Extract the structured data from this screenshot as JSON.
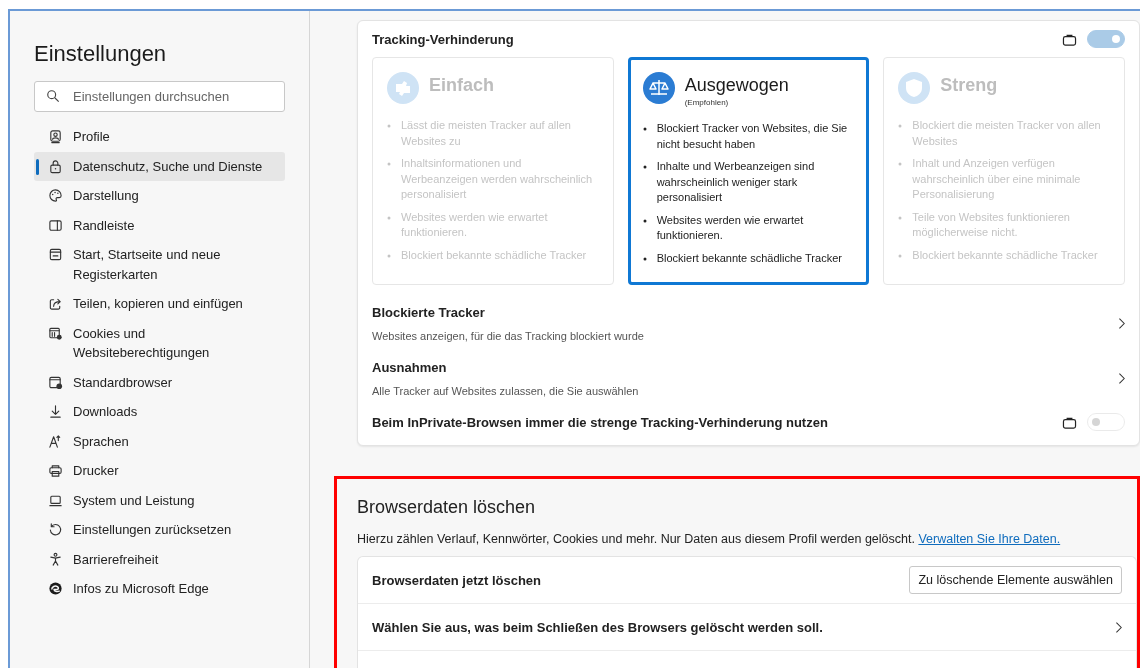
{
  "sidebar": {
    "title": "Einstellungen",
    "search": {
      "placeholder": "Einstellungen durchsuchen"
    },
    "items": [
      {
        "label": "Profile",
        "kind": "profile",
        "selected": false
      },
      {
        "label": "Datenschutz, Suche und Dienste",
        "kind": "lock",
        "selected": true
      },
      {
        "label": "Darstellung",
        "kind": "palette",
        "selected": false
      },
      {
        "label": "Randleiste",
        "kind": "panel",
        "selected": false
      },
      {
        "label": "Start, Startseite und neue Registerkarten",
        "kind": "newtab",
        "selected": false
      },
      {
        "label": "Teilen, kopieren und einfügen",
        "kind": "share",
        "selected": false
      },
      {
        "label": "Cookies und Websiteberechtigungen",
        "kind": "cookies",
        "selected": false
      },
      {
        "label": "Standardbrowser",
        "kind": "browser",
        "selected": false
      },
      {
        "label": "Downloads",
        "kind": "download",
        "selected": false
      },
      {
        "label": "Sprachen",
        "kind": "language",
        "selected": false
      },
      {
        "label": "Drucker",
        "kind": "printer",
        "selected": false
      },
      {
        "label": "System und Leistung",
        "kind": "laptop",
        "selected": false
      },
      {
        "label": "Einstellungen zurücksetzen",
        "kind": "reset",
        "selected": false
      },
      {
        "label": "Barrierefreiheit",
        "kind": "accessibility",
        "selected": false
      },
      {
        "label": "Infos zu Microsoft Edge",
        "kind": "edge",
        "selected": false
      }
    ]
  },
  "tracking": {
    "title": "Tracking-Verhinderung",
    "managed": true,
    "on": true,
    "levels": [
      {
        "title": "Einfach",
        "kind": "basic",
        "selected": false,
        "points": [
          "Lässt die meisten Tracker auf allen Websites zu",
          "Inhaltsinformationen und Werbeanzeigen werden wahrscheinlich personalisiert",
          "Websites werden wie erwartet funktionieren.",
          "Blockiert bekannte schädliche Tracker"
        ]
      },
      {
        "title": "Ausgewogen",
        "subtitle": "(Empfohlen)",
        "kind": "balanced",
        "selected": true,
        "points": [
          "Blockiert Tracker von Websites, die Sie nicht besucht haben",
          "Inhalte und Werbeanzeigen sind wahrscheinlich weniger stark personalisiert",
          "Websites werden wie erwartet funktionieren.",
          "Blockiert bekannte schädliche Tracker"
        ]
      },
      {
        "title": "Streng",
        "kind": "strict",
        "selected": false,
        "points": [
          "Blockiert die meisten Tracker von allen Websites",
          "Inhalt und Anzeigen verfügen wahrscheinlich über eine minimale Personalisierung",
          "Teile von Websites funktionieren möglicherweise nicht.",
          "Blockiert bekannte schädliche Tracker"
        ]
      }
    ],
    "links": [
      {
        "title": "Blockierte Tracker",
        "description": "Websites anzeigen, für die das Tracking blockiert wurde"
      },
      {
        "title": "Ausnahmen",
        "description": "Alle Tracker auf Websites zulassen, die Sie auswählen"
      }
    ],
    "inprivate": {
      "label": "Beim InPrivate-Browsen immer die strenge Tracking-Verhinderung nutzen",
      "managed": true,
      "on": false
    }
  },
  "clear_data": {
    "highlighted": true,
    "title": "Browserdaten löschen",
    "description": "Hierzu zählen Verlauf, Kennwörter, Cookies und mehr. Nur Daten aus diesem Profil werden gelöscht.",
    "link": "Verwalten Sie Ihre Daten.",
    "rows": [
      {
        "kind": "button",
        "label": "Browserdaten jetzt löschen",
        "button": "Zu löschende Elemente auswählen"
      },
      {
        "kind": "link",
        "label": "Wählen Sie aus, was beim Schließen des Browsers gelöscht werden soll."
      }
    ]
  }
}
